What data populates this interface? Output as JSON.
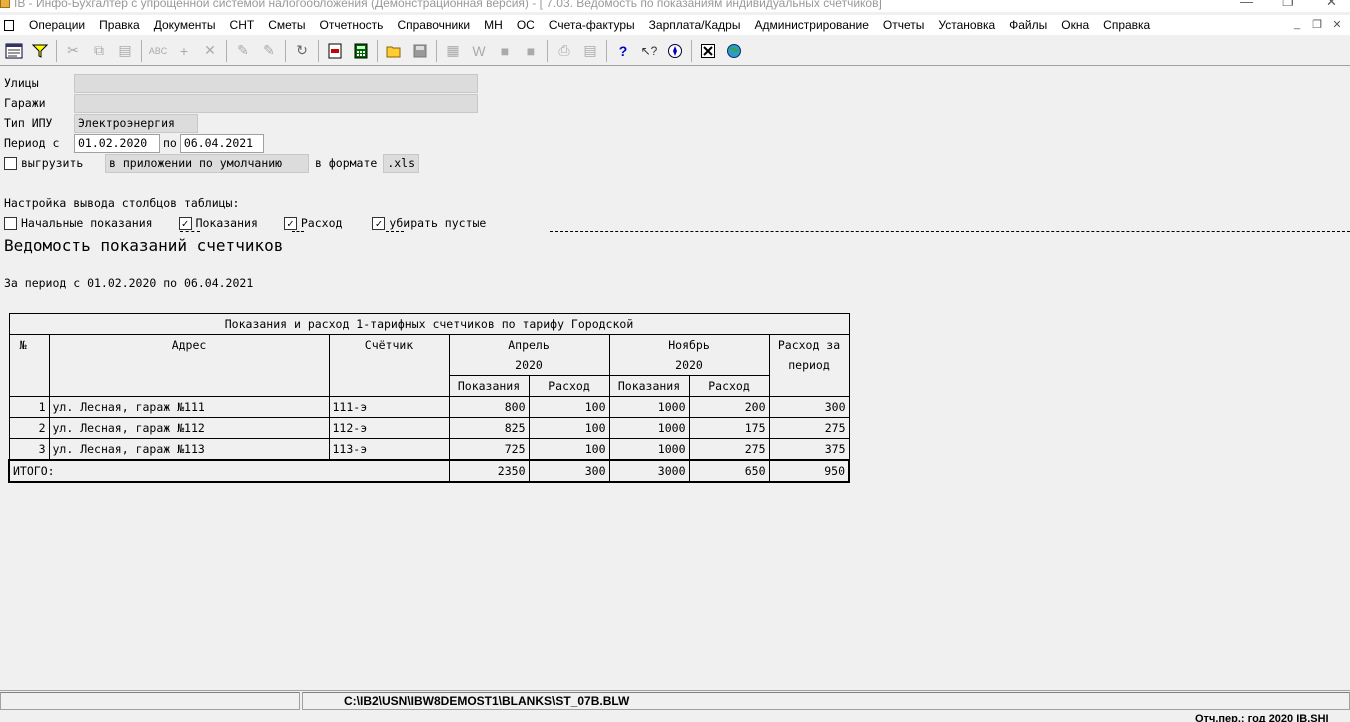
{
  "window": {
    "title": "IB - Инфо-Бухгалтер с упрощенной системой налогообложения (Демонстрационная версия) - [ 7.03. Ведомость по показаниям индивидуальных счетчиков]",
    "minimize": "—",
    "restore": "❐",
    "close": "✕"
  },
  "menu": {
    "items": [
      "Операции",
      "Правка",
      "Документы",
      "СНТ",
      "Сметы",
      "Отчетность",
      "Справочники",
      "МН",
      "ОС",
      "Счета-фактуры",
      "Зарплата/Кадры",
      "Администрирование",
      "Отчеты",
      "Установка",
      "Файлы",
      "Окна",
      "Справка"
    ],
    "mdi_minimize": "_",
    "mdi_restore": "❐",
    "mdi_close": "✕"
  },
  "toolbar": {
    "icons": [
      "report-view",
      "filter",
      "cut",
      "copy",
      "paste",
      "spellcheck",
      "add",
      "delete",
      "mark",
      "mark-all",
      "refresh",
      "pdf-export",
      "calculator",
      "open-folder",
      "save",
      "grid",
      "write",
      "block-a",
      "block-b",
      "print",
      "print-preview",
      "help",
      "context-help",
      "compass",
      "close-doc",
      "globe"
    ]
  },
  "form": {
    "streets_label": "Улицы",
    "streets_value": "",
    "garages_label": "Гаражи",
    "garages_value": "",
    "meter_type_label": "Тип ИПУ",
    "meter_type_value": "Электроэнергия",
    "period_label": "Период с",
    "period_from": "01.02.2020",
    "period_to_label": "по",
    "period_to": "06.04.2021",
    "export_label": "выгрузить",
    "export_checked": false,
    "export_app": "в приложении по умолчанию",
    "format_label": "в формате",
    "format_value": ".xls",
    "columns_heading": "Настройка вывода столбцов таблицы:",
    "col_initial_label": "Начальные показания",
    "col_initial_checked": false,
    "col_readings_label": "Показания",
    "col_readings_checked": true,
    "col_consumption_label": "Расход",
    "col_consumption_checked": true,
    "col_hide_empty_label": "убирать пустые",
    "col_hide_empty_checked": true
  },
  "report": {
    "title": "Ведомость показаний счетчиков",
    "period": "За период с 01.02.2020 по 06.04.2021",
    "table_caption": "Показания и расход 1-тарифных счетчиков по тарифу Городской",
    "headers": {
      "num": "№",
      "address": "Адрес",
      "meter": "Счётчик",
      "month1": "Апрель",
      "month1_year": "2020",
      "month2": "Ноябрь",
      "month2_year": "2020",
      "total_consumption_1": "Расход за",
      "total_consumption_2": "период",
      "readings": "Показания",
      "consumption": "Расход"
    },
    "rows": [
      {
        "num": "1",
        "address": "ул. Лесная, гараж №111",
        "meter": "111-э",
        "r1": "800",
        "c1": "100",
        "r2": "1000",
        "c2": "200",
        "total": "300"
      },
      {
        "num": "2",
        "address": "ул. Лесная, гараж №112",
        "meter": "112-э",
        "r1": "825",
        "c1": "100",
        "r2": "1000",
        "c2": "175",
        "total": "275"
      },
      {
        "num": "3",
        "address": "ул. Лесная, гараж №113",
        "meter": "113-э",
        "r1": "725",
        "c1": "100",
        "r2": "1000",
        "c2": "275",
        "total": "375"
      }
    ],
    "totals": {
      "label": "ИТОГО:",
      "r1": "2350",
      "c1": "300",
      "r2": "3000",
      "c2": "650",
      "total": "950"
    }
  },
  "status": {
    "path": "C:\\IB2\\USN\\IBW8DEMOST1\\BLANKS\\ST_07B.BLW",
    "period_info": "Отч.пер.: год 2020  IB.SHI"
  }
}
